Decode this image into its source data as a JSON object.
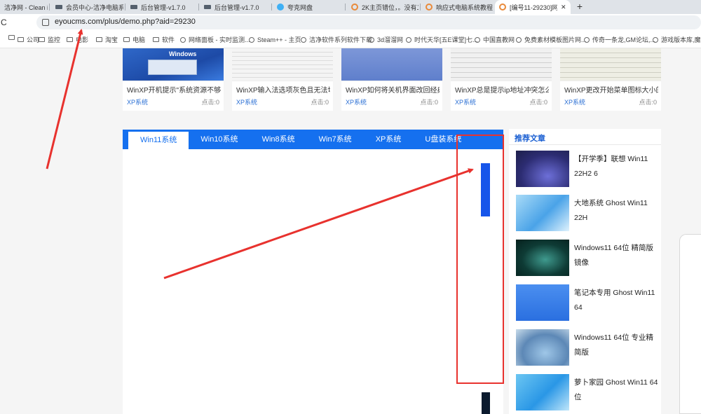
{
  "browser": {
    "tabs": [
      {
        "label": "洁净网 - Clean in",
        "active": false
      },
      {
        "label": "会员中心-洁净电脑系",
        "active": false
      },
      {
        "label": "后台管理-v1.7.0",
        "active": false
      },
      {
        "label": "后台管理-v1.7.0",
        "active": false
      },
      {
        "label": "夸克网盘",
        "active": false
      },
      {
        "label": "2K主页错位，。没有二",
        "active": false
      },
      {
        "label": "响应式电脑系统教程网",
        "active": false
      },
      {
        "label": "[编号11-29230]网",
        "active": true
      }
    ],
    "close_glyph": "✕",
    "new_tab_glyph": "+",
    "reload_glyph": "C",
    "url": "eyoucms.com/plus/demo.php?aid=29230",
    "bookmarks": [
      {
        "label": "公司",
        "icon": "folder-icon"
      },
      {
        "label": "监控",
        "icon": "folder-icon"
      },
      {
        "label": "电影",
        "icon": "folder-icon"
      },
      {
        "label": "淘宝",
        "icon": "folder-icon"
      },
      {
        "label": "电脑",
        "icon": "folder-icon"
      },
      {
        "label": "软件",
        "icon": "folder-icon"
      },
      {
        "label": "网络面板 - 实时监测...",
        "icon": "globe-icon"
      },
      {
        "label": "Steam++ - 主页",
        "icon": "globe-icon"
      },
      {
        "label": "洁净软件系列软件下载",
        "icon": "globe-icon"
      },
      {
        "label": "3d溜溜网",
        "icon": "globe-icon"
      },
      {
        "label": "时代天华[五E课堂]七...",
        "icon": "globe-icon"
      },
      {
        "label": "中国直教网",
        "icon": "globe-icon"
      },
      {
        "label": "免费素材模板图片网...",
        "icon": "globe-icon"
      },
      {
        "label": "传奇一条龙,GM论坛,...",
        "icon": "globe-icon"
      },
      {
        "label": "游戏版本库,魔域私...",
        "icon": "globe-icon"
      }
    ]
  },
  "top_cards": [
    {
      "title": "WinXP开机提示\"系统资源不够 无",
      "category": "XP系统",
      "clicks": "点击:0",
      "thumb_text": "Windows"
    },
    {
      "title": "WinXP输入法选项灰色且无法切",
      "category": "XP系统",
      "clicks": "点击:0",
      "thumb_text": ""
    },
    {
      "title": "WinXP如何将关机界面改回经典",
      "category": "XP系统",
      "clicks": "点击:0",
      "thumb_text": ""
    },
    {
      "title": "WinXP总是提示ip地址冲突怎么",
      "category": "XP系统",
      "clicks": "点击:0",
      "thumb_text": ""
    },
    {
      "title": "WinXP更改开始菜单图标大小的",
      "category": "XP系统",
      "clicks": "点击:0",
      "thumb_text": ""
    }
  ],
  "panel": {
    "tabs": [
      "Win11系统",
      "Win10系统",
      "Win8系统",
      "Win7系统",
      "XP系统",
      "U盘装系统"
    ],
    "active_tab": 0
  },
  "sidebar": {
    "heading": "推荐文章",
    "items": [
      {
        "title": "【开学季】联想 Win11 22H2 6"
      },
      {
        "title": "大地系统 Ghost Win11 22H"
      },
      {
        "title": "Windows11 64位 精简版镜像"
      },
      {
        "title": "笔记本专用 Ghost Win11 64"
      },
      {
        "title": "Windows11 64位 专业精简版"
      },
      {
        "title": "萝卜家园 Ghost Win11 64位"
      }
    ]
  },
  "colors": {
    "accent": "#1570ef",
    "annotation": "#e8322e",
    "link": "#2a6fd4"
  }
}
